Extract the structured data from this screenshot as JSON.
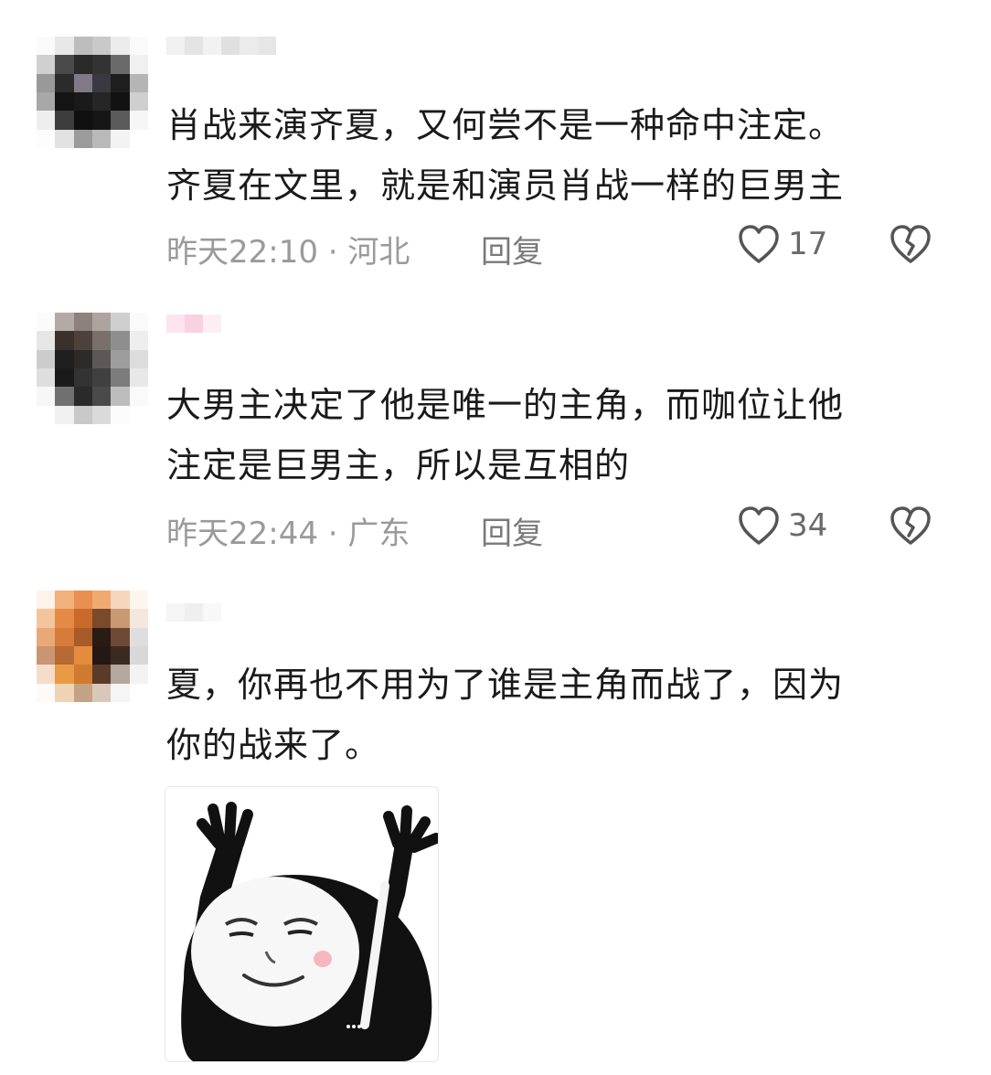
{
  "comments": [
    {
      "text_line1": "肖战来演齐夏，又何尝不是一种命中注定。",
      "text_line2": "齐夏在文里，就是和演员肖战一样的巨男主",
      "time_location": "昨天22:10 · 河北",
      "reply_label": "回复",
      "like_count": "17"
    },
    {
      "text_line1": "大男主决定了他是唯一的主角，而咖位让他",
      "text_line2": "注定是巨男主，所以是互相的",
      "time_location": "昨天22:44 · 广东",
      "reply_label": "回复",
      "like_count": "34"
    },
    {
      "text_line1": "夏，你再也不用为了谁是主角而战了，因为",
      "text_line2": "你的战来了。"
    }
  ],
  "icons": {
    "like": "heart-outline-icon",
    "dislike": "broken-heart-icon"
  },
  "colors": {
    "text": "#1a1a1a",
    "meta": "#9a9a9a",
    "icon": "#555555"
  }
}
